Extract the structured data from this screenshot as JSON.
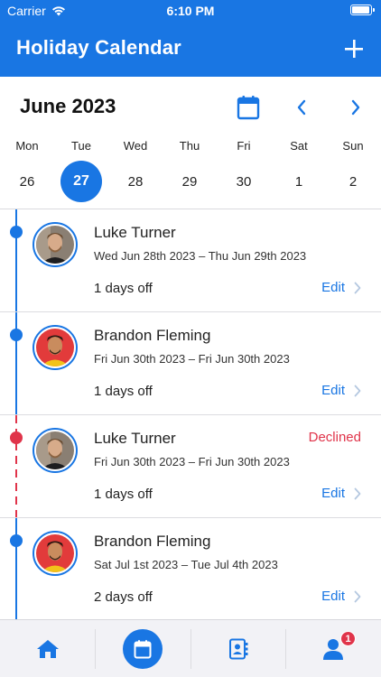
{
  "status_bar": {
    "carrier": "Carrier",
    "time": "6:10 PM"
  },
  "nav": {
    "title": "Holiday Calendar",
    "add_icon": "plus-icon"
  },
  "calendar": {
    "month_label": "June 2023",
    "weekdays": [
      "Mon",
      "Tue",
      "Wed",
      "Thu",
      "Fri",
      "Sat",
      "Sun"
    ],
    "dates": [
      "26",
      "27",
      "28",
      "29",
      "30",
      "1",
      "2"
    ],
    "selected_index": 1
  },
  "colors": {
    "primary": "#1976e3",
    "declined": "#e0344a",
    "tab_background": "#f2f2f6"
  },
  "requests": [
    {
      "name": "Luke Turner",
      "range": "Wed Jun 28th 2023 – Thu Jun 29th 2023",
      "days_off": "1 days off",
      "status": "",
      "edit_label": "Edit",
      "avatar": "luke"
    },
    {
      "name": "Brandon Fleming",
      "range": "Fri Jun 30th 2023 – Fri Jun 30th 2023",
      "days_off": "1 days off",
      "status": "",
      "edit_label": "Edit",
      "avatar": "brandon"
    },
    {
      "name": "Luke Turner",
      "range": "Fri Jun 30th 2023 – Fri Jun 30th 2023",
      "days_off": "1 days off",
      "status": "Declined",
      "edit_label": "Edit",
      "avatar": "luke"
    },
    {
      "name": "Brandon Fleming",
      "range": "Sat Jul 1st 2023 – Tue Jul 4th 2023",
      "days_off": "2 days off",
      "status": "",
      "edit_label": "Edit",
      "avatar": "brandon"
    }
  ],
  "tabbar": {
    "icons": [
      "home-icon",
      "calendar-icon",
      "contacts-icon",
      "profile-icon"
    ],
    "profile_badge": "1"
  }
}
